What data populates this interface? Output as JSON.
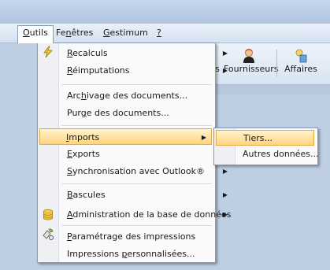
{
  "menubar": {
    "items": [
      {
        "text": "Outils",
        "u": "O",
        "rest": "utils"
      },
      {
        "text": "Fenêtres",
        "pre": "Fe",
        "u": "n",
        "rest": "êtres"
      },
      {
        "text": "Gestimum",
        "u": "G",
        "rest": "estimum"
      },
      {
        "text": "?",
        "u": "?",
        "rest": ""
      }
    ]
  },
  "toolbar": {
    "cut_label": "s",
    "suppliers_label": "Fournisseurs",
    "affairs_label": "Affaires"
  },
  "dropdown": {
    "items": [
      {
        "pre": "",
        "u": "R",
        "rest": "ecalculs",
        "arrow": "▶"
      },
      {
        "pre": "",
        "u": "R",
        "rest": "éimputations",
        "arrow": "▶"
      },
      {
        "pre": "Arc",
        "u": "h",
        "rest": "ivage des documents...",
        "arrow": ""
      },
      {
        "pre": "Pur",
        "u": "g",
        "rest": "e des documents...",
        "arrow": ""
      },
      {
        "pre": "",
        "u": "I",
        "rest": "mports",
        "arrow": "▶"
      },
      {
        "pre": "",
        "u": "E",
        "rest": "xports",
        "arrow": "▶"
      },
      {
        "pre": "",
        "u": "S",
        "rest": "ynchronisation avec Outlook®",
        "arrow": "▶"
      },
      {
        "pre": "",
        "u": "B",
        "rest": "ascules",
        "arrow": "▶"
      },
      {
        "pre": "",
        "u": "A",
        "rest": "dministration de la base de données",
        "arrow": "▶"
      },
      {
        "pre": "",
        "u": "P",
        "rest": "aramétrage des impressions",
        "arrow": ""
      },
      {
        "pre": "Impressions ",
        "u": "p",
        "rest": "ersonnalisées...",
        "arrow": ""
      }
    ]
  },
  "submenu": {
    "items": [
      {
        "pre": "",
        "u": "T",
        "rest": "iers..."
      },
      {
        "pre": "A",
        "u": "u",
        "rest": "tres données..."
      }
    ]
  }
}
